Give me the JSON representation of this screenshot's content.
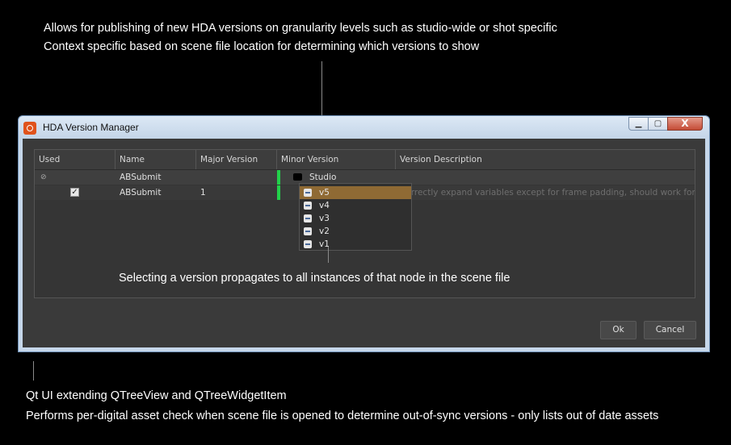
{
  "annotations": {
    "top_line1": "Allows for publishing of new HDA versions on granularity levels such as studio-wide or shot specific",
    "top_line2": "Context specific based on scene file location for determining which versions to show",
    "middle": "Selecting a version propagates to all instances of that node in the scene file",
    "bottom_line1": "Qt UI extending QTreeView and QTreeWidgetItem",
    "bottom_line2": "Performs per-digital asset check when scene file is opened to determine out-of-sync versions - only lists out of date assets"
  },
  "window": {
    "title": "HDA Version Manager",
    "min_glyph": "▁",
    "max_glyph": "▢",
    "close_glyph": "X"
  },
  "tree": {
    "headers": [
      "Used",
      "Name",
      "Major Version",
      "Minor Version",
      "Version Description"
    ],
    "rows": [
      {
        "used_marker": "⊘",
        "name": "ABSubmit",
        "major": "",
        "minor": "Studio",
        "description": ""
      },
      {
        "used_checked": true,
        "check_glyph": "✓",
        "name": "ABSubmit",
        "major": "1",
        "minor": "v5",
        "description": "Correctly expand variables except for frame padding, should work for…"
      }
    ]
  },
  "dropdown": {
    "items": [
      "v5",
      "v4",
      "v3",
      "v2",
      "v1"
    ],
    "selected": "v5"
  },
  "buttons": {
    "ok": "Ok",
    "cancel": "Cancel"
  },
  "colors": {
    "background": "#000000",
    "dialog_bg": "#3a3a3a",
    "selection": "#8f6a34",
    "green_marker": "#22d14a",
    "titlebar": "#c4d5e8"
  }
}
